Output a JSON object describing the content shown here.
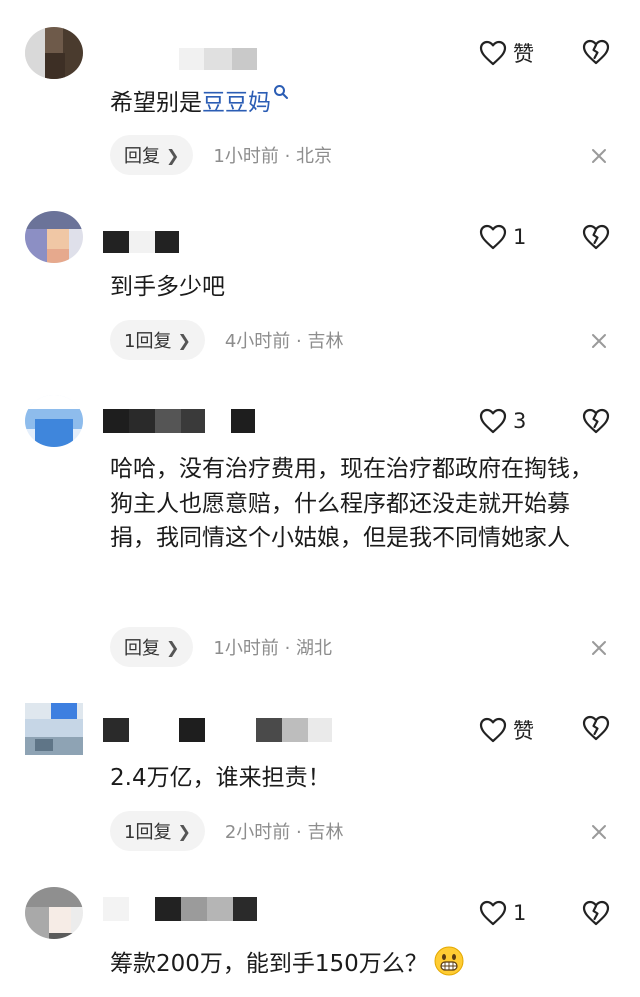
{
  "comments": [
    {
      "text_prefix": "希望别是",
      "mention": "豆豆妈",
      "like_label": "赞",
      "reply_label": "回复",
      "time_location": "1小时前 · 北京"
    },
    {
      "text": "到手多少吧",
      "like_label": "1",
      "reply_label": "1回复",
      "time_location": "4小时前 · 吉林"
    },
    {
      "text": "哈哈，没有治疗费用，现在治疗都政府在掏钱，狗主人也愿意赔，什么程序都还没走就开始募捐，我同情这个小姑娘，但是我不同情她家人",
      "like_label": "3",
      "reply_label": "回复",
      "time_location": "1小时前 · 湖北"
    },
    {
      "text": "2.4万亿，谁来担责！",
      "like_label": "赞",
      "reply_label": "1回复",
      "time_location": "2小时前 · 吉林"
    },
    {
      "text": "筹款200万，能到手150万么？",
      "like_label": "1",
      "emoji": "grinning-face-icon"
    }
  ],
  "icons": {
    "like": "heart-outline-icon",
    "dislike": "broken-heart-icon",
    "close": "close-icon",
    "search": "search-icon",
    "chevron": "chevron-right-icon"
  },
  "colors": {
    "mention": "#2b5db4",
    "meta_text": "#8d8d8d",
    "pill_bg": "#f3f3f3"
  }
}
